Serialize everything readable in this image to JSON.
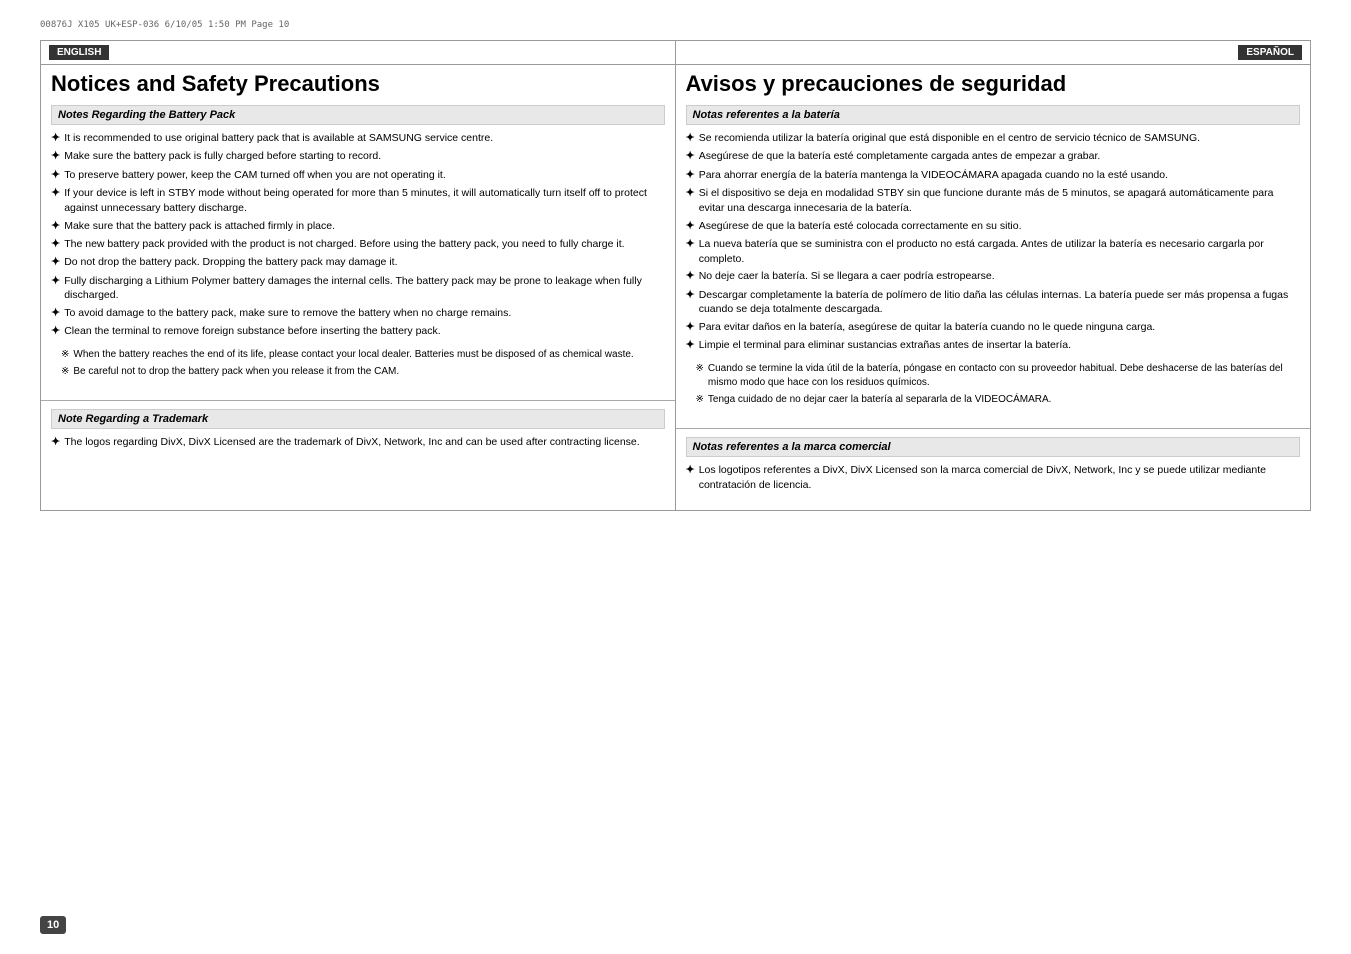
{
  "header_meta": "00876J X105 UK+ESP-036   6/10/05 1:50 PM   Page 10",
  "page_number": "10",
  "english": {
    "lang_badge": "ENGLISH",
    "title": "Notices and Safety Precautions",
    "battery_section": {
      "heading": "Notes Regarding the Battery Pack",
      "bullets": [
        "It is recommended to use original battery pack that is available at SAMSUNG service centre.",
        "Make sure the battery pack is fully charged before starting to record.",
        "To preserve battery power, keep the CAM turned off when you are not operating it.",
        "If your device is left in STBY mode without being operated for more than 5 minutes, it will automatically turn itself off to protect against unnecessary battery discharge.",
        "Make sure that the battery pack is attached firmly in place.",
        "The new battery pack provided with the product is not charged. Before using the battery pack, you need to fully charge it.",
        "Do not drop the battery pack. Dropping the battery pack may damage it.",
        "Fully discharging a Lithium Polymer battery damages the internal cells. The battery pack may be prone to leakage when fully discharged.",
        "To avoid damage to the battery pack, make sure to remove the battery when no charge remains.",
        "Clean the terminal to remove foreign substance before inserting the battery pack."
      ],
      "notes": [
        "When the battery reaches the end of its life, please contact your local dealer. Batteries must be disposed of as chemical waste.",
        "Be careful not to drop the battery pack when you release it from the CAM."
      ]
    },
    "trademark_section": {
      "heading": "Note Regarding a Trademark",
      "bullets": [
        "The logos regarding DivX, DivX Licensed are the trademark of DivX, Network, Inc and can be used after contracting license."
      ]
    }
  },
  "spanish": {
    "lang_badge": "ESPAÑOL",
    "title": "Avisos y precauciones de seguridad",
    "battery_section": {
      "heading": "Notas referentes a la batería",
      "bullets": [
        "Se recomienda utilizar la batería original que está disponible en el centro de servicio técnico de SAMSUNG.",
        "Asegúrese de que la batería esté completamente cargada antes de empezar a grabar.",
        "Para ahorrar energía de la batería mantenga la VIDEOCÁMARA apagada cuando no la esté usando.",
        "Si el dispositivo se deja en modalidad STBY sin que funcione durante más de 5 minutos, se apagará automáticamente para evitar una descarga innecesaria de la batería.",
        "Asegúrese de que la batería esté colocada correctamente en su sitio.",
        "La nueva batería que se suministra con el producto no está cargada. Antes de utilizar la batería es necesario cargarla por completo.",
        "No deje caer la batería. Si se llegara a caer podría estropearse.",
        "Descargar completamente la batería de polímero de litio daña las células internas. La batería puede ser más propensa a fugas cuando se deja totalmente descargada.",
        "Para evitar daños en la batería, asegúrese de quitar la batería cuando no le quede ninguna carga.",
        "Limpie el terminal para eliminar sustancias extrañas antes de insertar la batería."
      ],
      "notes": [
        "Cuando se termine la vida útil de la batería, póngase en contacto con su proveedor habitual. Debe deshacerse de las baterías del mismo modo que hace con los residuos químicos.",
        "Tenga cuidado de no dejar caer la batería al separarla de la VIDEOCÁMARA."
      ]
    },
    "trademark_section": {
      "heading": "Notas referentes a la marca comercial",
      "bullets": [
        "Los logotipos referentes a DivX, DivX Licensed son la marca comercial de DivX, Network, Inc y se puede utilizar mediante contratación de licencia."
      ]
    }
  }
}
